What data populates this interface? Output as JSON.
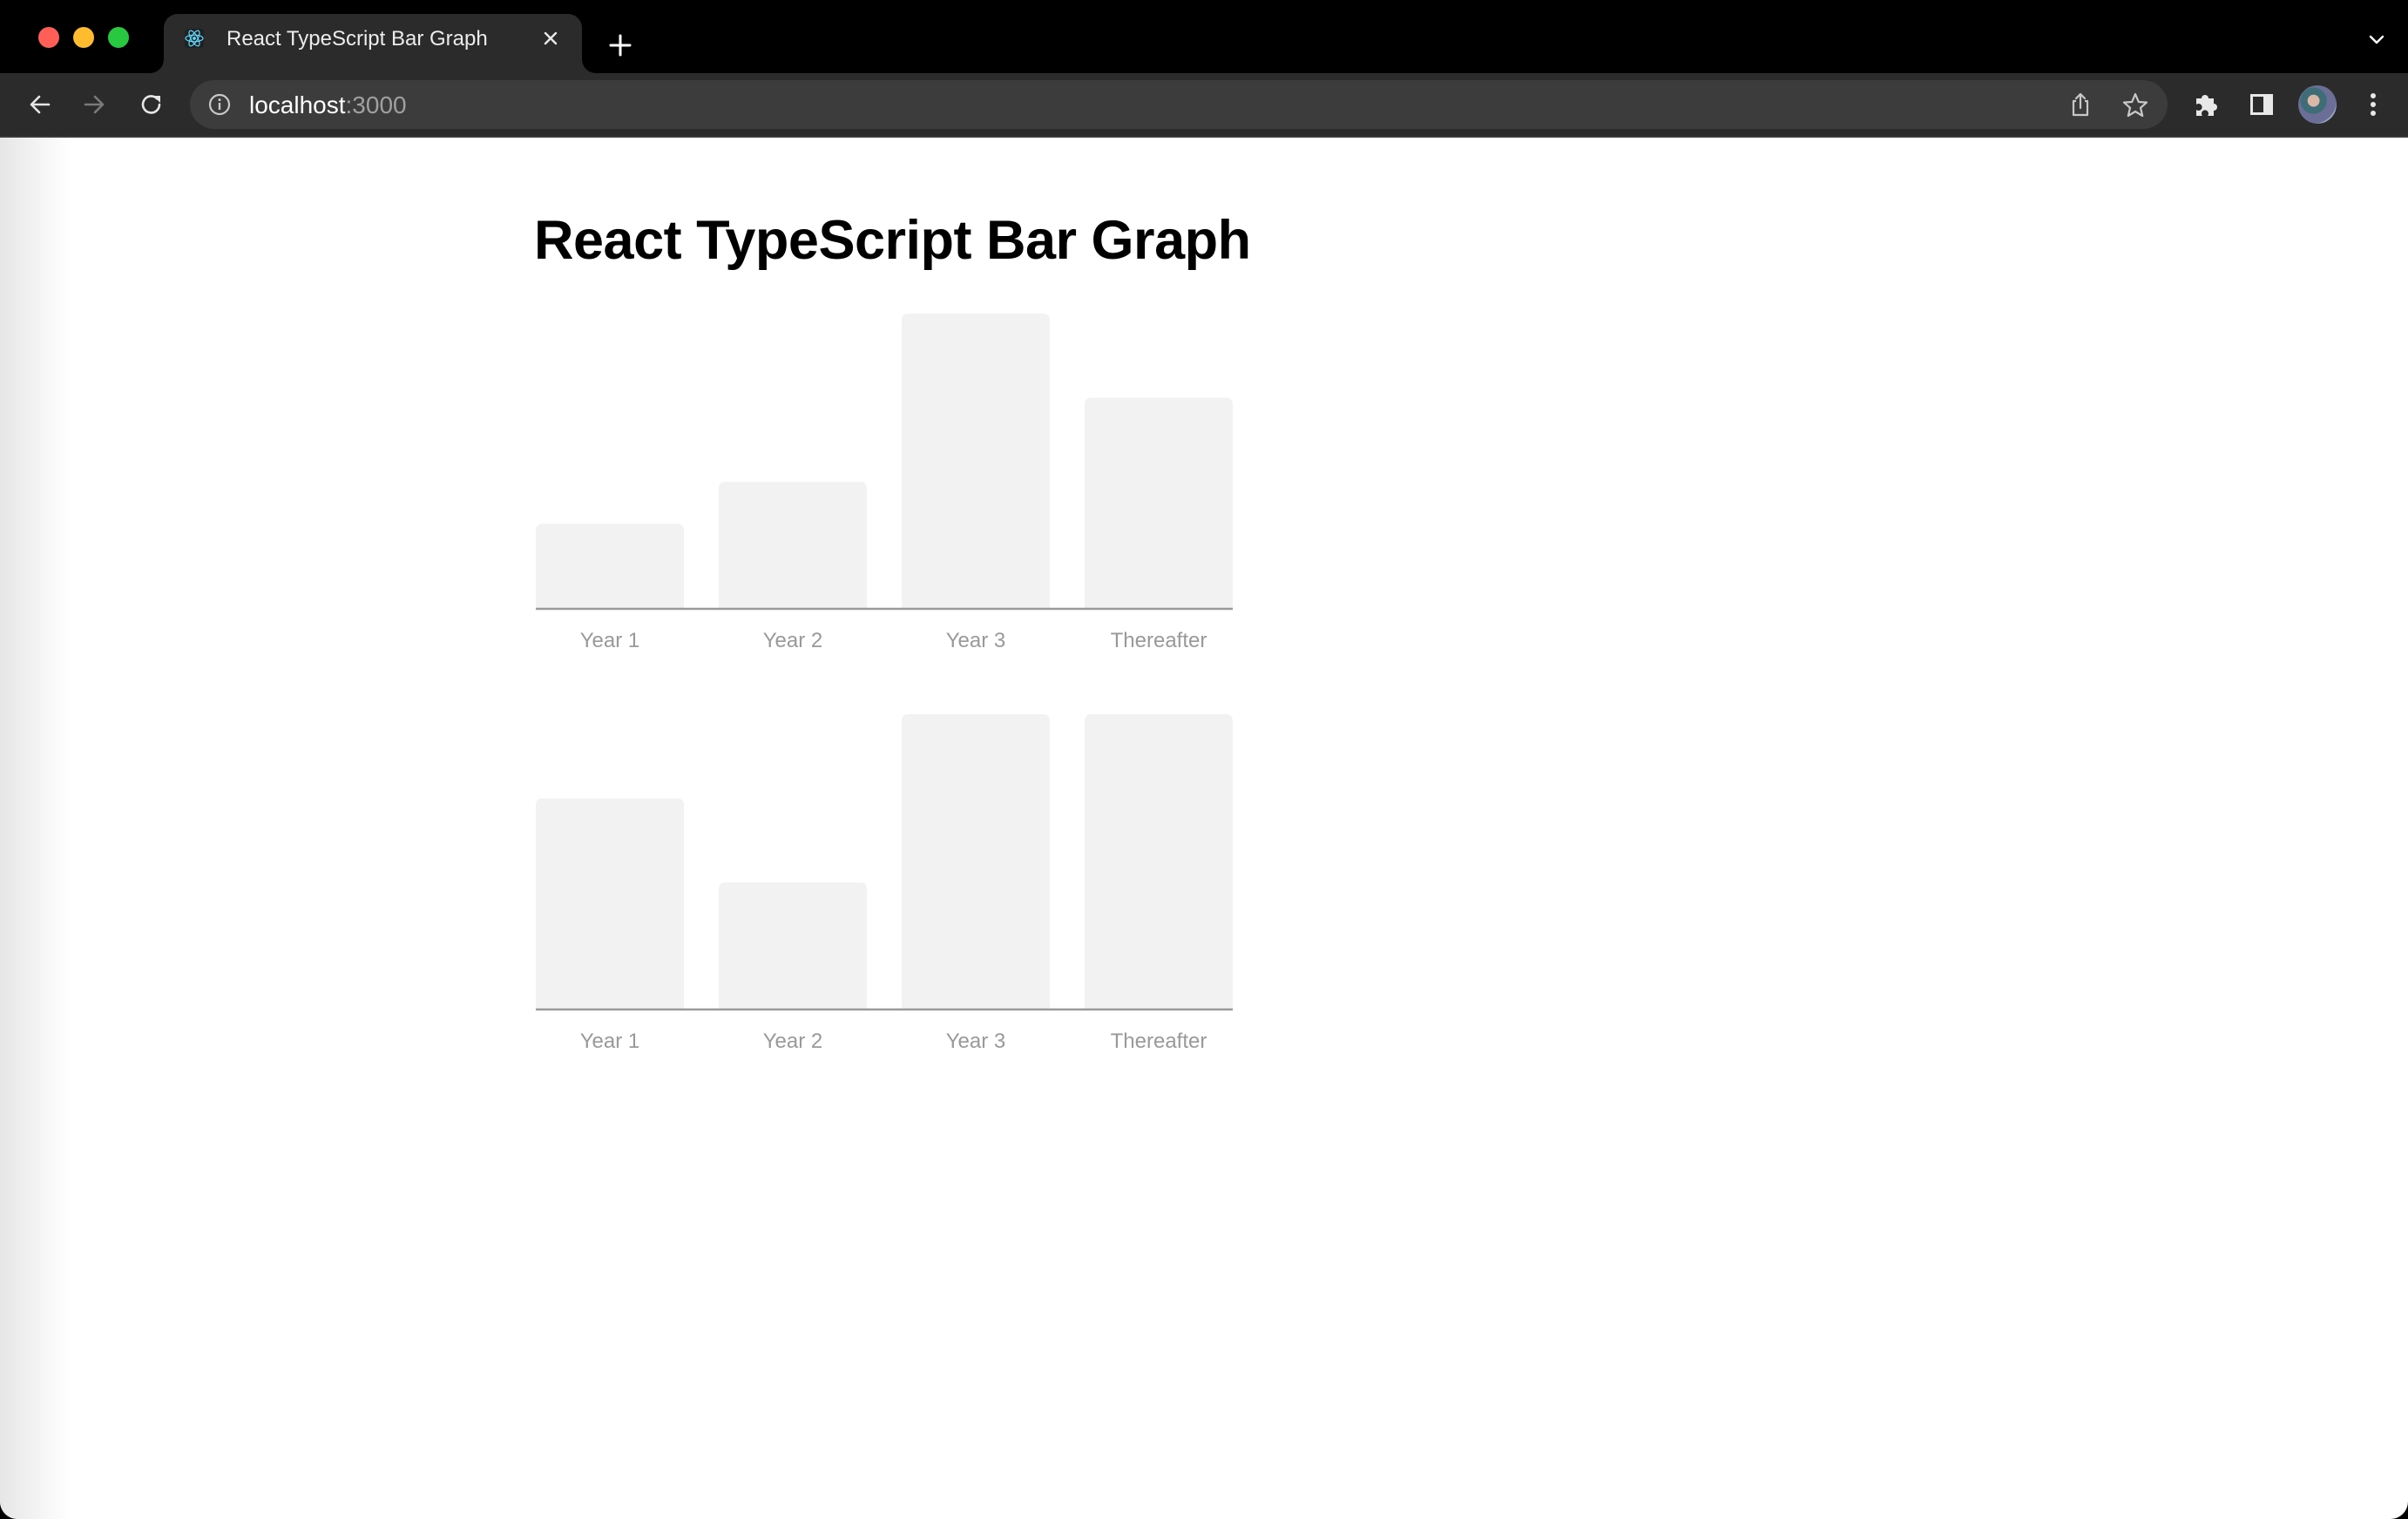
{
  "browser": {
    "tab": {
      "title": "React TypeScript Bar Graph",
      "favicon": "react-logo-icon",
      "close_icon": "close-icon"
    },
    "new_tab_icon": "plus-icon",
    "tab_search_icon": "chevron-down-icon",
    "nav": {
      "back_icon": "arrow-left-icon",
      "forward_icon": "arrow-right-icon",
      "reload_icon": "reload-icon"
    },
    "address_bar": {
      "host": "localhost",
      "port": ":3000",
      "info_icon": "info-icon",
      "share_icon": "share-icon",
      "bookmark_icon": "star-icon"
    },
    "toolbar_icons": [
      "puzzle-icon",
      "side-panel-icon",
      "avatar",
      "more-vert-icon"
    ],
    "traffic_lights": {
      "close": "#ff5f57",
      "minimize": "#febc2e",
      "maximize": "#28c840"
    }
  },
  "page": {
    "title": "React TypeScript Bar Graph"
  },
  "colors": {
    "bar": "#f2f2f2",
    "axis": "#9a9a9a",
    "label": "#999999"
  },
  "chart_data": [
    {
      "type": "bar",
      "title": "",
      "xlabel": "",
      "ylabel": "",
      "categories": [
        "Year 1",
        "Year 2",
        "Year 3",
        "Thereafter"
      ],
      "values": [
        2,
        3,
        7,
        5
      ],
      "ylim": [
        0,
        7
      ],
      "grid": false,
      "legend": "none"
    },
    {
      "type": "bar",
      "title": "",
      "xlabel": "",
      "ylabel": "",
      "categories": [
        "Year 1",
        "Year 2",
        "Year 3",
        "Thereafter"
      ],
      "values": [
        5,
        3,
        7,
        7
      ],
      "ylim": [
        0,
        7
      ],
      "grid": false,
      "legend": "none"
    }
  ]
}
